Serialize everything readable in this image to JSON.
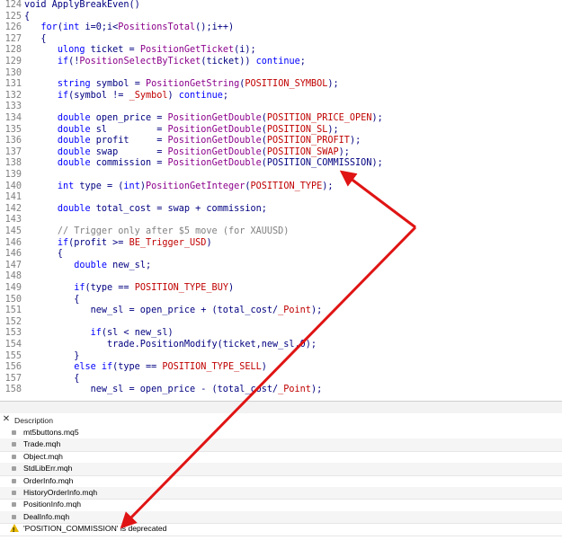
{
  "code_lines": [
    {
      "num": "124",
      "parts": [
        {
          "t": "void ApplyBreakEven()",
          "c": ""
        }
      ]
    },
    {
      "num": "125",
      "parts": [
        {
          "t": "{",
          "c": ""
        }
      ]
    },
    {
      "num": "126",
      "parts": [
        {
          "t": "   ",
          "c": ""
        },
        {
          "t": "for",
          "c": "kw"
        },
        {
          "t": "(",
          "c": ""
        },
        {
          "t": "int",
          "c": "kw"
        },
        {
          "t": " i=0;i<",
          "c": ""
        },
        {
          "t": "PositionsTotal",
          "c": "fn"
        },
        {
          "t": "();i++)",
          "c": ""
        }
      ]
    },
    {
      "num": "127",
      "parts": [
        {
          "t": "   {",
          "c": ""
        }
      ]
    },
    {
      "num": "128",
      "parts": [
        {
          "t": "      ",
          "c": ""
        },
        {
          "t": "ulong",
          "c": "kw"
        },
        {
          "t": " ticket = ",
          "c": ""
        },
        {
          "t": "PositionGetTicket",
          "c": "fn"
        },
        {
          "t": "(i);",
          "c": ""
        }
      ]
    },
    {
      "num": "129",
      "parts": [
        {
          "t": "      ",
          "c": ""
        },
        {
          "t": "if",
          "c": "kw"
        },
        {
          "t": "(!",
          "c": ""
        },
        {
          "t": "PositionSelectByTicket",
          "c": "fn"
        },
        {
          "t": "(ticket)) ",
          "c": ""
        },
        {
          "t": "continue",
          "c": "kw"
        },
        {
          "t": ";",
          "c": ""
        }
      ]
    },
    {
      "num": "130",
      "parts": [
        {
          "t": "",
          "c": ""
        }
      ]
    },
    {
      "num": "131",
      "parts": [
        {
          "t": "      ",
          "c": ""
        },
        {
          "t": "string",
          "c": "kw"
        },
        {
          "t": " symbol = ",
          "c": ""
        },
        {
          "t": "PositionGetString",
          "c": "fn"
        },
        {
          "t": "(",
          "c": ""
        },
        {
          "t": "POSITION_SYMBOL",
          "c": "const"
        },
        {
          "t": ");",
          "c": ""
        }
      ]
    },
    {
      "num": "132",
      "parts": [
        {
          "t": "      ",
          "c": ""
        },
        {
          "t": "if",
          "c": "kw"
        },
        {
          "t": "(symbol != ",
          "c": ""
        },
        {
          "t": "_Symbol",
          "c": "const"
        },
        {
          "t": ") ",
          "c": ""
        },
        {
          "t": "continue",
          "c": "kw"
        },
        {
          "t": ";",
          "c": ""
        }
      ]
    },
    {
      "num": "133",
      "parts": [
        {
          "t": "",
          "c": ""
        }
      ]
    },
    {
      "num": "134",
      "parts": [
        {
          "t": "      ",
          "c": ""
        },
        {
          "t": "double",
          "c": "kw"
        },
        {
          "t": " open_price = ",
          "c": ""
        },
        {
          "t": "PositionGetDouble",
          "c": "fn"
        },
        {
          "t": "(",
          "c": ""
        },
        {
          "t": "POSITION_PRICE_OPEN",
          "c": "const"
        },
        {
          "t": ");",
          "c": ""
        }
      ]
    },
    {
      "num": "135",
      "parts": [
        {
          "t": "      ",
          "c": ""
        },
        {
          "t": "double",
          "c": "kw"
        },
        {
          "t": " sl         = ",
          "c": ""
        },
        {
          "t": "PositionGetDouble",
          "c": "fn"
        },
        {
          "t": "(",
          "c": ""
        },
        {
          "t": "POSITION_SL",
          "c": "const"
        },
        {
          "t": ");",
          "c": ""
        }
      ]
    },
    {
      "num": "136",
      "parts": [
        {
          "t": "      ",
          "c": ""
        },
        {
          "t": "double",
          "c": "kw"
        },
        {
          "t": " profit     = ",
          "c": ""
        },
        {
          "t": "PositionGetDouble",
          "c": "fn"
        },
        {
          "t": "(",
          "c": ""
        },
        {
          "t": "POSITION_PROFIT",
          "c": "const"
        },
        {
          "t": ");",
          "c": ""
        }
      ]
    },
    {
      "num": "137",
      "parts": [
        {
          "t": "      ",
          "c": ""
        },
        {
          "t": "double",
          "c": "kw"
        },
        {
          "t": " swap       = ",
          "c": ""
        },
        {
          "t": "PositionGetDouble",
          "c": "fn"
        },
        {
          "t": "(",
          "c": ""
        },
        {
          "t": "POSITION_SWAP",
          "c": "const"
        },
        {
          "t": ");",
          "c": ""
        }
      ]
    },
    {
      "num": "138",
      "parts": [
        {
          "t": "      ",
          "c": ""
        },
        {
          "t": "double",
          "c": "kw"
        },
        {
          "t": " commission = ",
          "c": ""
        },
        {
          "t": "PositionGetDouble",
          "c": "fn"
        },
        {
          "t": "(POSITION_COMMISSION);",
          "c": ""
        }
      ]
    },
    {
      "num": "139",
      "parts": [
        {
          "t": "",
          "c": ""
        }
      ]
    },
    {
      "num": "140",
      "parts": [
        {
          "t": "      ",
          "c": ""
        },
        {
          "t": "int",
          "c": "kw"
        },
        {
          "t": " type = (",
          "c": ""
        },
        {
          "t": "int",
          "c": "kw"
        },
        {
          "t": ")",
          "c": ""
        },
        {
          "t": "PositionGetInteger",
          "c": "fn"
        },
        {
          "t": "(",
          "c": ""
        },
        {
          "t": "POSITION_TYPE",
          "c": "const"
        },
        {
          "t": ");",
          "c": ""
        }
      ]
    },
    {
      "num": "141",
      "parts": [
        {
          "t": "",
          "c": ""
        }
      ]
    },
    {
      "num": "142",
      "parts": [
        {
          "t": "      ",
          "c": ""
        },
        {
          "t": "double",
          "c": "kw"
        },
        {
          "t": " total_cost = swap + commission;",
          "c": ""
        }
      ]
    },
    {
      "num": "143",
      "parts": [
        {
          "t": "",
          "c": ""
        }
      ]
    },
    {
      "num": "145",
      "parts": [
        {
          "t": "      ",
          "c": ""
        },
        {
          "t": "// Trigger only after $5 move (for XAUUSD)",
          "c": "cmt"
        }
      ]
    },
    {
      "num": "146",
      "parts": [
        {
          "t": "      ",
          "c": ""
        },
        {
          "t": "if",
          "c": "kw"
        },
        {
          "t": "(profit >= ",
          "c": ""
        },
        {
          "t": "BE_Trigger_USD",
          "c": "const"
        },
        {
          "t": ")",
          "c": ""
        }
      ]
    },
    {
      "num": "146",
      "parts": [
        {
          "t": "      {",
          "c": ""
        }
      ]
    },
    {
      "num": "147",
      "parts": [
        {
          "t": "         ",
          "c": ""
        },
        {
          "t": "double",
          "c": "kw"
        },
        {
          "t": " new_sl;",
          "c": ""
        }
      ]
    },
    {
      "num": "148",
      "parts": [
        {
          "t": "",
          "c": ""
        }
      ]
    },
    {
      "num": "149",
      "parts": [
        {
          "t": "         ",
          "c": ""
        },
        {
          "t": "if",
          "c": "kw"
        },
        {
          "t": "(type == ",
          "c": ""
        },
        {
          "t": "POSITION_TYPE_BUY",
          "c": "const"
        },
        {
          "t": ")",
          "c": ""
        }
      ]
    },
    {
      "num": "150",
      "parts": [
        {
          "t": "         {",
          "c": ""
        }
      ]
    },
    {
      "num": "151",
      "parts": [
        {
          "t": "            new_sl = open_price + (total_cost/",
          "c": ""
        },
        {
          "t": "_Point",
          "c": "const"
        },
        {
          "t": ");",
          "c": ""
        }
      ]
    },
    {
      "num": "152",
      "parts": [
        {
          "t": "",
          "c": ""
        }
      ]
    },
    {
      "num": "153",
      "parts": [
        {
          "t": "            ",
          "c": ""
        },
        {
          "t": "if",
          "c": "kw"
        },
        {
          "t": "(sl < new_sl)",
          "c": ""
        }
      ]
    },
    {
      "num": "154",
      "parts": [
        {
          "t": "               trade.PositionModify(ticket,new_sl,0);",
          "c": ""
        }
      ]
    },
    {
      "num": "155",
      "parts": [
        {
          "t": "         }",
          "c": ""
        }
      ]
    },
    {
      "num": "156",
      "parts": [
        {
          "t": "         ",
          "c": ""
        },
        {
          "t": "else if",
          "c": "kw"
        },
        {
          "t": "(type == ",
          "c": ""
        },
        {
          "t": "POSITION_TYPE_SELL",
          "c": "const"
        },
        {
          "t": ")",
          "c": ""
        }
      ]
    },
    {
      "num": "157",
      "parts": [
        {
          "t": "         {",
          "c": ""
        }
      ]
    },
    {
      "num": "158",
      "parts": [
        {
          "t": "            new_sl = open_price - (total_cost/",
          "c": ""
        },
        {
          "t": "_Point",
          "c": "const"
        },
        {
          "t": ");",
          "c": ""
        }
      ]
    }
  ],
  "panel": {
    "close_glyph": "✕",
    "header": "Description",
    "rows": [
      {
        "text": "mt5buttons.mq5",
        "icon": "file-icon"
      },
      {
        "text": "Trade.mqh",
        "icon": "file-icon"
      },
      {
        "text": "Object.mqh",
        "icon": "file-icon"
      },
      {
        "text": "StdLibErr.mqh",
        "icon": "file-icon"
      },
      {
        "text": "OrderInfo.mqh",
        "icon": "file-icon"
      },
      {
        "text": "HistoryOrderInfo.mqh",
        "icon": "file-icon"
      },
      {
        "text": "PositionInfo.mqh",
        "icon": "file-icon"
      },
      {
        "text": "DealInfo.mqh",
        "icon": "file-icon"
      }
    ],
    "warning": {
      "text": "'POSITION_COMMISSION' is deprecated",
      "icon": "warning-icon",
      "glyph": "!"
    }
  },
  "annotation": {
    "color": "#e01414"
  }
}
